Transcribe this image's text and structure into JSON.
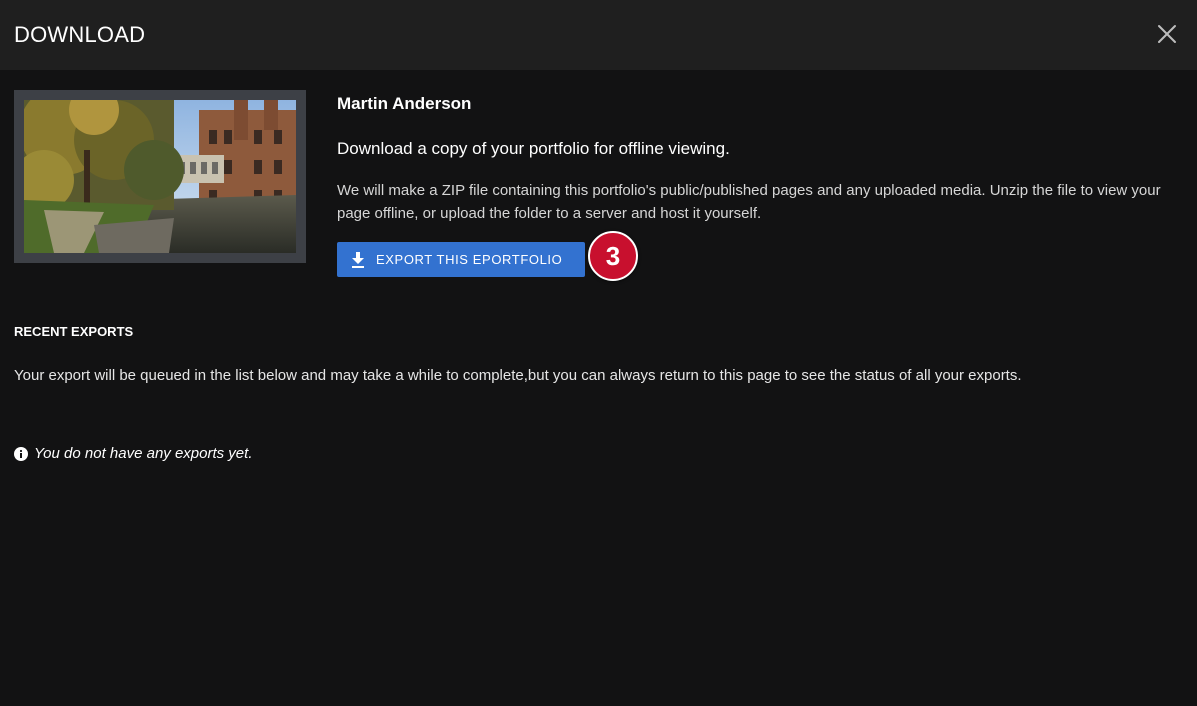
{
  "header": {
    "title": "DOWNLOAD",
    "close_icon": "close-icon"
  },
  "portfolio": {
    "thumbnail_icon": "portfolio-thumbnail-image",
    "owner_name": "Martin Anderson",
    "lead": "Download a copy of your portfolio for offline viewing.",
    "description": "We will make a ZIP file containing this portfolio's public/published pages and any uploaded media. Unzip the file to view your page offline, or upload the folder to a server and host it yourself.",
    "export_button_label": "EXPORT THIS EPORTFOLIO",
    "export_icon": "download-icon",
    "step_number": "3"
  },
  "recent_exports": {
    "title": "RECENT EXPORTS",
    "description": "Your export will be queued in the list below and may take a while to complete,but you can always return to this page to see the status of all your exports.",
    "empty_message": "You do not have any exports yet.",
    "empty_icon": "info-icon"
  },
  "colors": {
    "header_bg": "#1f1f1f",
    "body_bg": "#121213",
    "button_blue": "#3372d0",
    "badge_red": "#c8102e"
  }
}
